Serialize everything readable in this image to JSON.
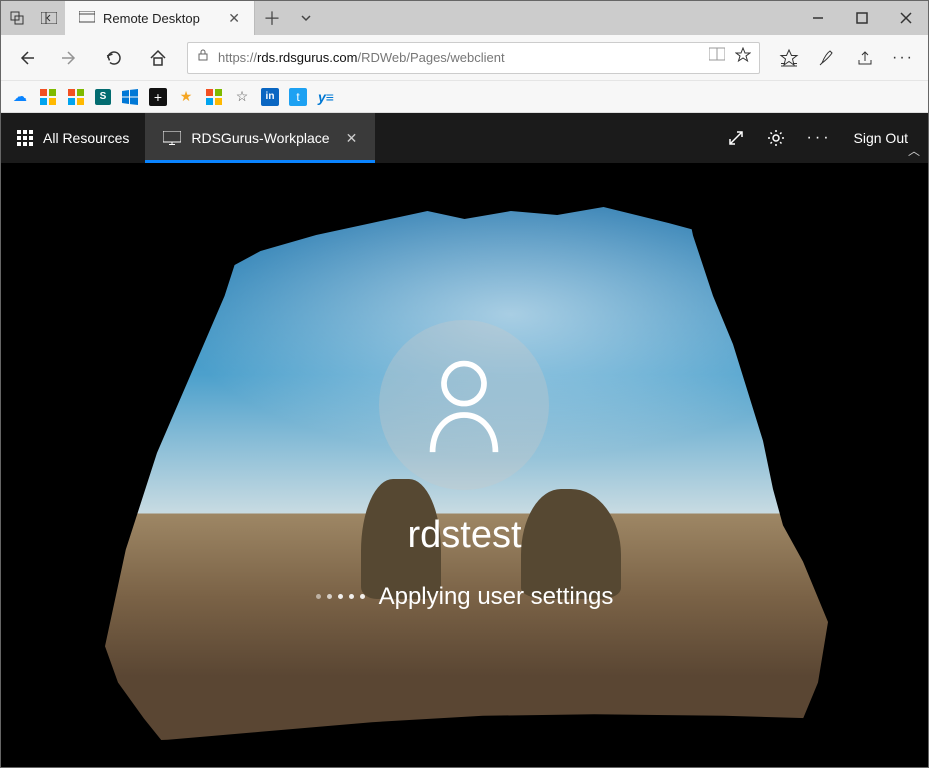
{
  "browser": {
    "tab_title": "Remote Desktop",
    "url_prefix": "https://",
    "url_domain": "rds.rdsgurus.com",
    "url_path": "/RDWeb/Pages/webclient"
  },
  "favorites": [
    "onedrive-icon",
    "windows-tiles-icon",
    "microsoft-icon",
    "sharepoint-icon",
    "windows-icon",
    "plus-box-icon",
    "star-icon",
    "microsoft-alt-icon",
    "star-outline-icon",
    "linkedin-icon",
    "twitter-icon",
    "yammer-icon"
  ],
  "rd": {
    "all_resources": "All Resources",
    "active_session": "RDSGurus-Workplace",
    "sign_out": "Sign Out"
  },
  "session": {
    "username": "rdstest",
    "status": "Applying user settings"
  }
}
